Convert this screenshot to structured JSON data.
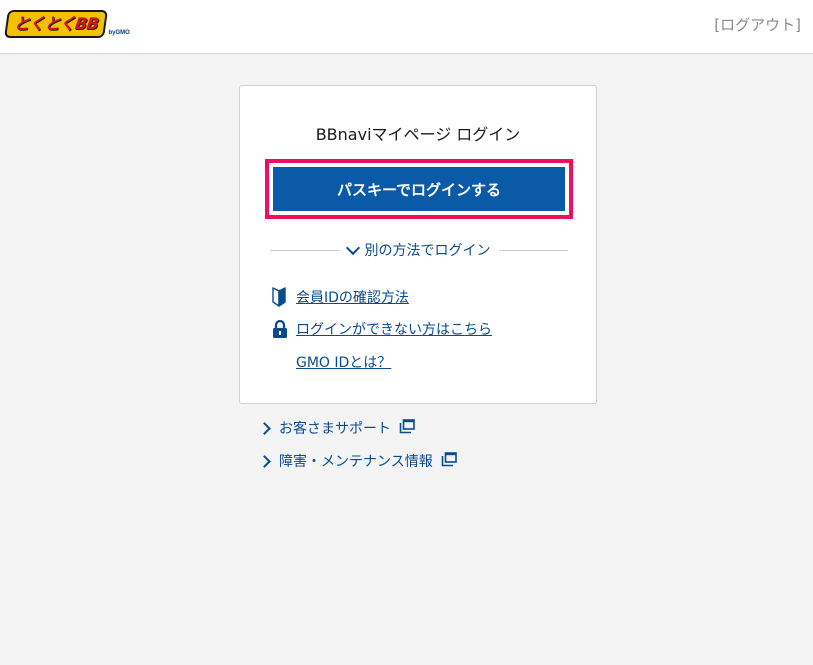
{
  "header": {
    "logo_text": "とくとくBB",
    "logo_sub": "byGMO",
    "logout_label": "[ログアウト]"
  },
  "card": {
    "title": "BBnaviマイページ ログイン",
    "passkey_button_label": "パスキーでログインする",
    "alt_login_label": "別の方法でログイン",
    "links": [
      {
        "label": "会員IDの確認方法",
        "icon": "beginner-mark-icon"
      },
      {
        "label": "ログインができない方はこちら",
        "icon": "lock-icon"
      },
      {
        "label": "GMO IDとは？",
        "icon": ""
      }
    ]
  },
  "support": {
    "items": [
      {
        "label": "お客さまサポート",
        "icon": "external-window-icon"
      },
      {
        "label": "障害・メンテナンス情報",
        "icon": "external-window-icon"
      }
    ]
  },
  "colors": {
    "primary_blue": "#0a5aa8",
    "link_blue": "#0a4a8f",
    "highlight_pink": "#f0105a",
    "background": "#f4f4f4"
  }
}
